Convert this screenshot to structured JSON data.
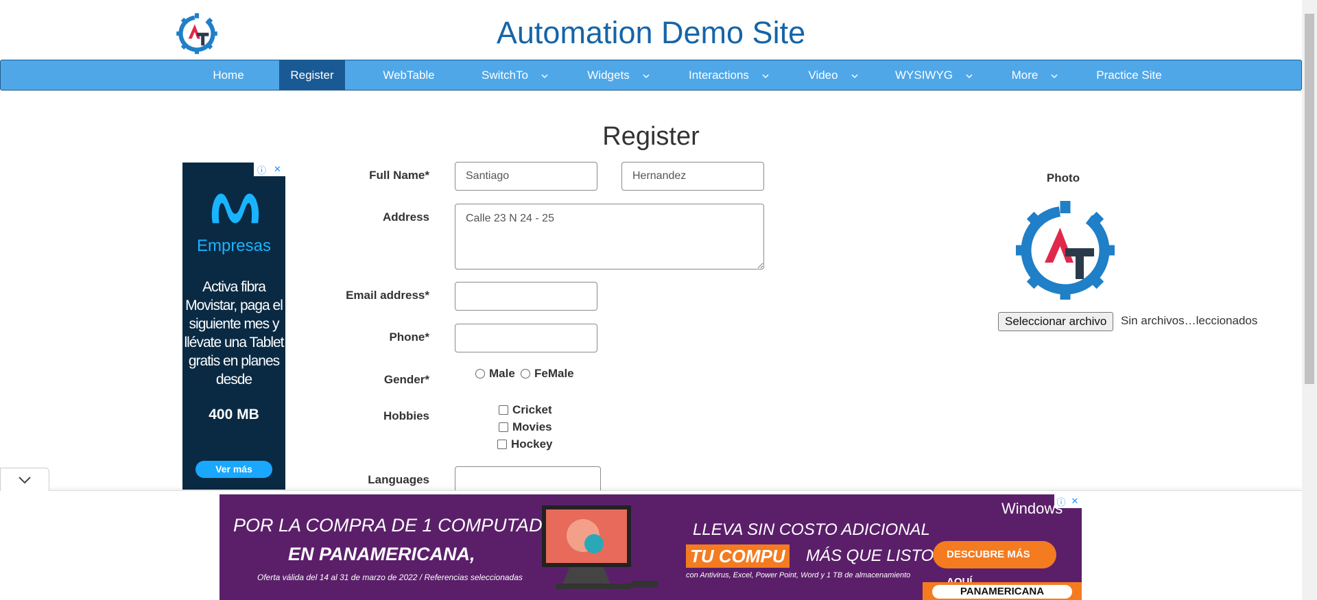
{
  "header": {
    "site_title": "Automation Demo Site",
    "logo_letters": "AT"
  },
  "nav": {
    "items": [
      {
        "label": "Home",
        "dropdown": false,
        "active": false
      },
      {
        "label": "Register",
        "dropdown": false,
        "active": true
      },
      {
        "label": "WebTable",
        "dropdown": false,
        "active": false
      },
      {
        "label": "SwitchTo",
        "dropdown": true,
        "active": false
      },
      {
        "label": "Widgets",
        "dropdown": true,
        "active": false
      },
      {
        "label": "Interactions",
        "dropdown": true,
        "active": false
      },
      {
        "label": "Video",
        "dropdown": true,
        "active": false
      },
      {
        "label": "WYSIWYG",
        "dropdown": true,
        "active": false
      },
      {
        "label": "More",
        "dropdown": true,
        "active": false
      },
      {
        "label": "Practice Site",
        "dropdown": false,
        "active": false
      }
    ]
  },
  "form": {
    "heading": "Register",
    "full_name_label": "Full Name*",
    "first_name_value": "Santiago",
    "last_name_value": "Hernandez",
    "address_label": "Address",
    "address_value": "Calle 23 N 24 - 25",
    "email_label": "Email address*",
    "email_value": "",
    "phone_label": "Phone*",
    "phone_value": "",
    "gender_label": "Gender*",
    "gender_options": [
      "Male",
      "FeMale"
    ],
    "hobbies_label": "Hobbies",
    "hobbies_options": [
      "Cricket",
      "Movies",
      "Hockey"
    ],
    "languages_label": "Languages"
  },
  "photo": {
    "label": "Photo",
    "choose_button": "Seleccionar archivo",
    "file_status": "Sin archivos…leccionados"
  },
  "side_ad": {
    "brand": "Empresas",
    "body": "Activa fibra Movistar, paga el siguiente mes y llévate una Tablet gratis en planes desde",
    "highlight": "400 MB",
    "cta": "Ver más",
    "brand_color": "#19b4ff",
    "background": "#0a2a43"
  },
  "bottom_ad": {
    "line1": "POR LA COMPRA DE 1 COMPUTADOR",
    "line2": "EN PANAMERICANA,",
    "fine_print": "Oferta válida del 14 al 31 de marzo de 2022 / Referencias seleccionadas",
    "right_line1": "LLEVA SIN COSTO ADICIONAL",
    "tag": "TU COMPU",
    "right_line2": "MÁS QUE LISTO",
    "right_fine": "con Antivirus, Excel, Power Point, Word y 1 TB de almacenamiento",
    "button": "DESCUBRE MÁS AQUÍ",
    "windows": "Windows",
    "store": "PANAMERICANA",
    "background": "#5b1f6a",
    "accent": "#f47b20"
  },
  "colors": {
    "nav_bg": "#4fa7e8",
    "nav_active": "#1a5a94",
    "title": "#1565a8"
  }
}
